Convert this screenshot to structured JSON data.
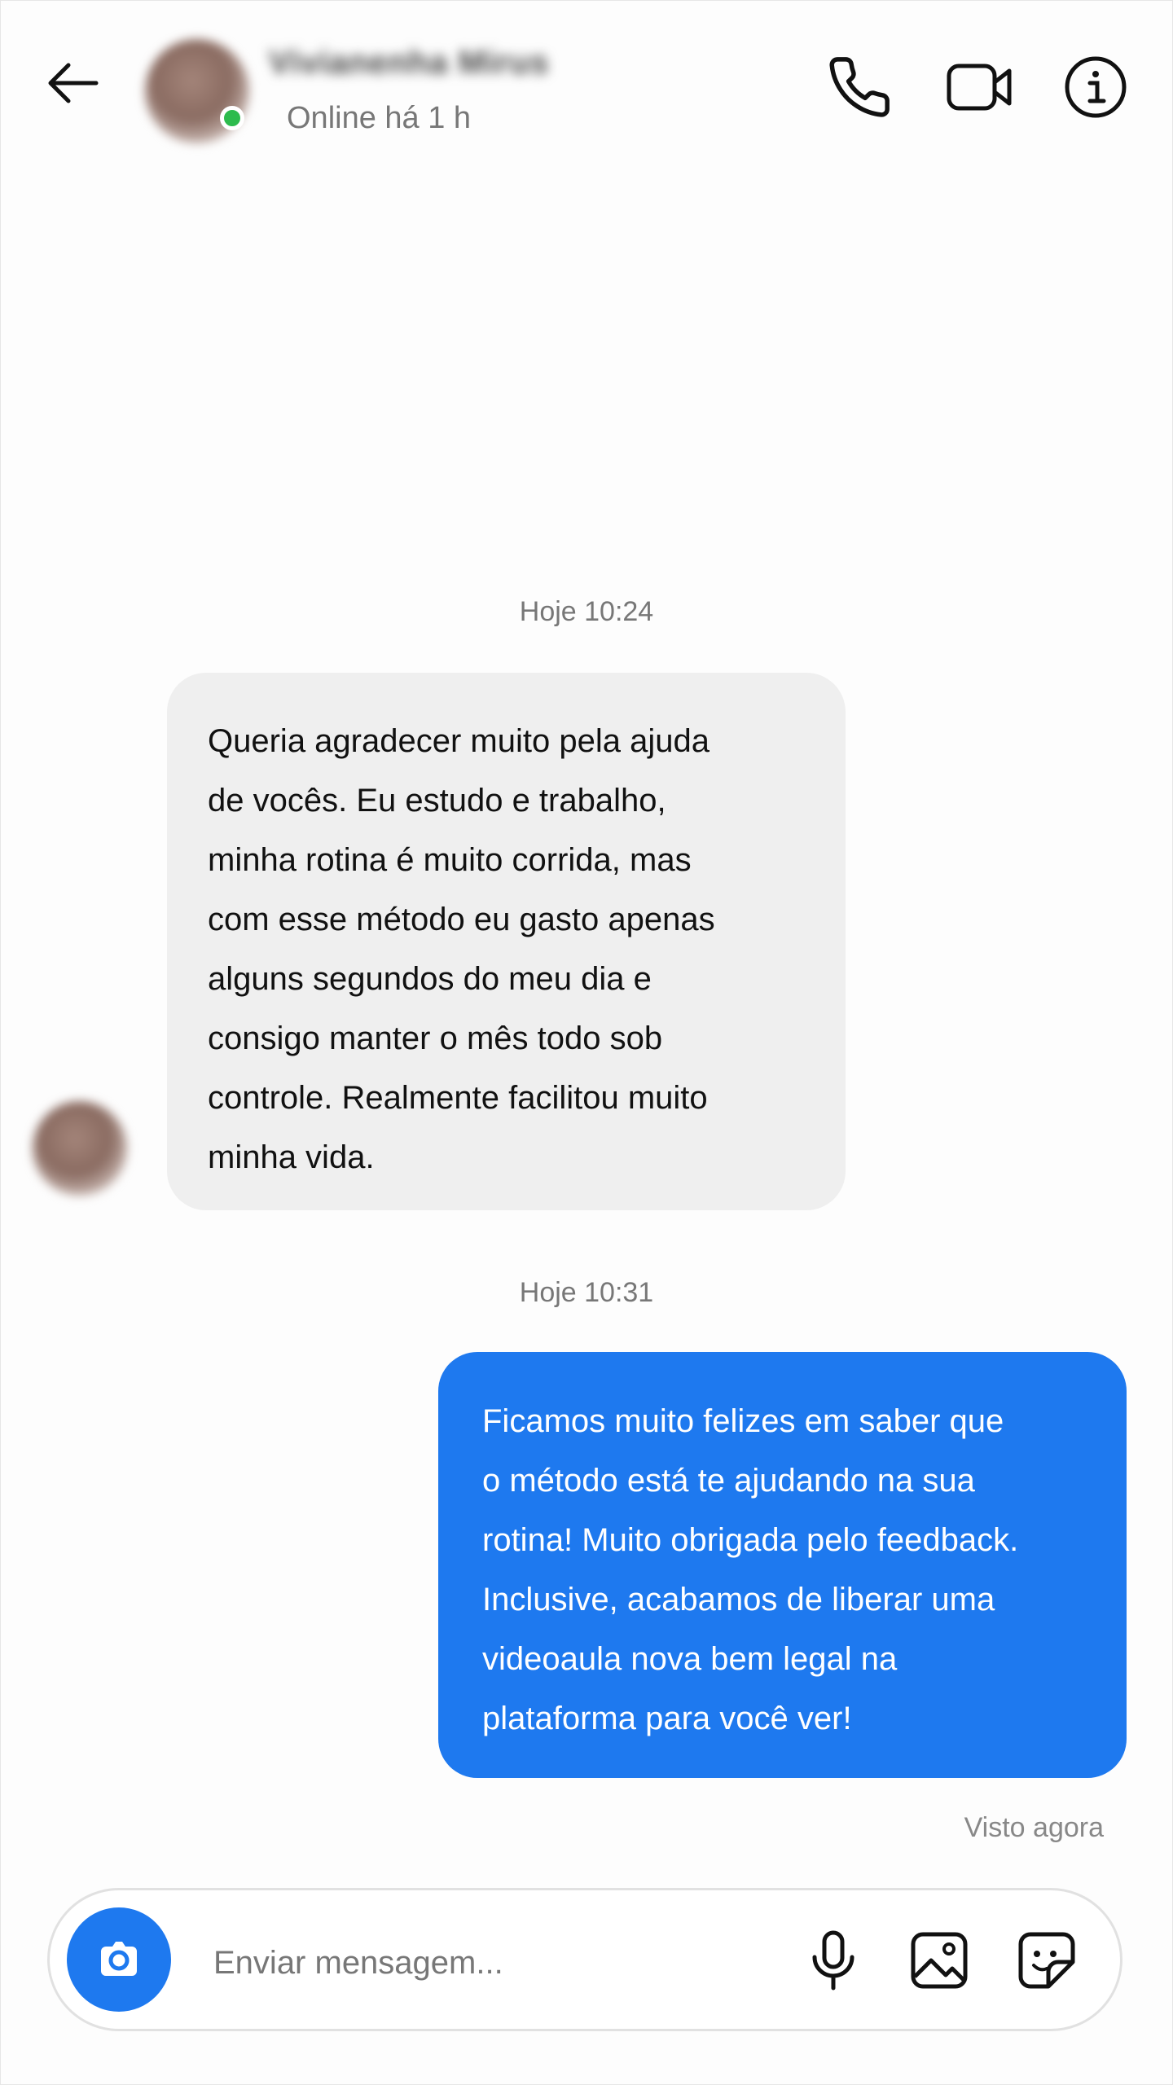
{
  "header": {
    "contact_name": "Vivianenha Mirus",
    "status": "Online há 1 h"
  },
  "messages": [
    {
      "timestamp": "Hoje 10:24",
      "direction": "incoming",
      "text": "Queria agradecer muito pela ajuda\nde vocês. Eu estudo e trabalho,\nminha rotina é muito corrida, mas\ncom esse método eu gasto apenas\nalguns segundos do meu dia e\nconsigo manter o mês todo sob\ncontrole. Realmente facilitou muito\nminha vida."
    },
    {
      "timestamp": "Hoje 10:31",
      "direction": "outgoing",
      "text": "Ficamos muito felizes em saber que\no método está te ajudando na sua\nrotina! Muito obrigada pelo feedback.\nInclusive, acabamos de liberar uma\nvideoaula nova bem legal na\nplataforma para você ver!"
    }
  ],
  "seen_status": "Visto agora",
  "composer": {
    "placeholder": "Enviar mensagem..."
  },
  "icons": {
    "back": "arrow-left-icon",
    "call": "phone-icon",
    "video": "video-camera-icon",
    "info": "info-icon",
    "camera": "camera-icon",
    "mic": "microphone-icon",
    "gallery": "image-icon",
    "sticker": "sticker-icon"
  },
  "colors": {
    "accent": "#1e79ef",
    "incoming_bubble": "#efefef",
    "online": "#2dbb4d"
  }
}
